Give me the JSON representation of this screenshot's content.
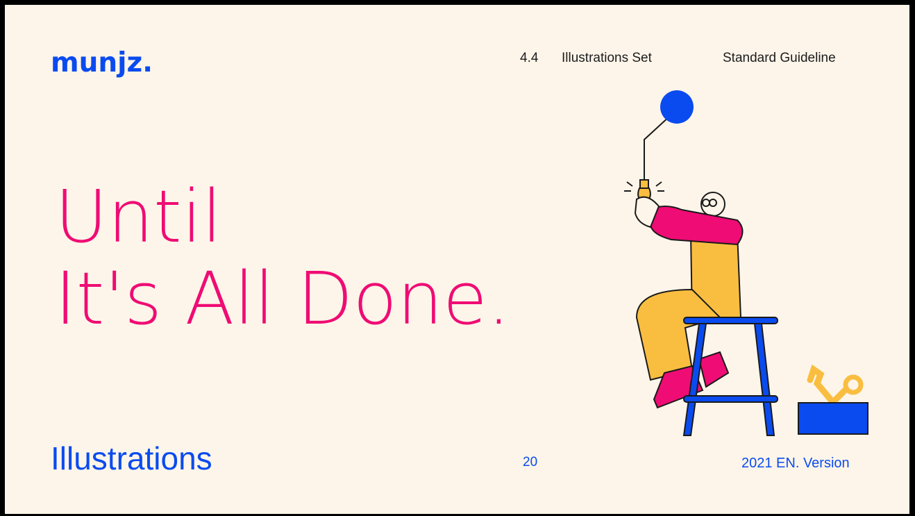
{
  "brand": {
    "logo": "munjz."
  },
  "header": {
    "section_number": "4.4",
    "section_title": "Illustrations Set",
    "guide_title": "Standard Guideline"
  },
  "headline": {
    "line1": "Until",
    "line2": "It's All Done."
  },
  "footer": {
    "title": "Illustrations",
    "page_number": "20",
    "version": "2021 EN. Version"
  },
  "colors": {
    "background": "#fdf5e9",
    "brand_blue": "#0a4bf0",
    "accent_pink": "#ef0c74",
    "accent_yellow": "#f9be40"
  },
  "illustration": {
    "icons": [
      "balloon-icon",
      "light-bulb-icon",
      "person-icon",
      "stool-icon",
      "toolbox-icon",
      "wrench-icon"
    ]
  }
}
